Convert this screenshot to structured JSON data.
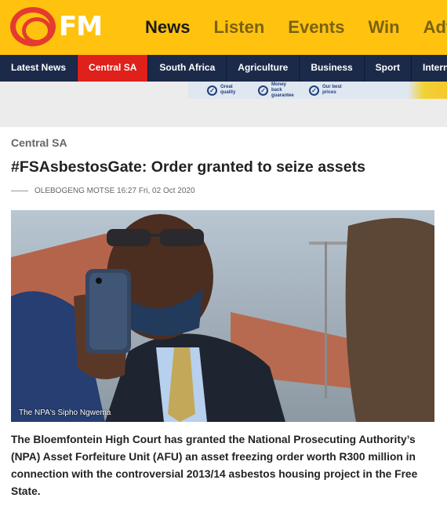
{
  "header": {
    "logo_text": "OFM",
    "nav": [
      {
        "label": "News",
        "active": true
      },
      {
        "label": "Listen",
        "active": false
      },
      {
        "label": "Events",
        "active": false
      },
      {
        "label": "Win",
        "active": false
      },
      {
        "label": "Adv",
        "active": false
      }
    ]
  },
  "subnav": [
    {
      "label": "Latest News",
      "active": false
    },
    {
      "label": "Central SA",
      "active": true
    },
    {
      "label": "South Africa",
      "active": false
    },
    {
      "label": "Agriculture",
      "active": false
    },
    {
      "label": "Business",
      "active": false
    },
    {
      "label": "Sport",
      "active": false
    },
    {
      "label": "Intern",
      "active": false
    }
  ],
  "ad": {
    "items": [
      "Great\nquality",
      "Money back\nguarantee",
      "Our best\nprices"
    ]
  },
  "article": {
    "category": "Central SA",
    "title": "#FSAsbestosGate: Order granted to seize assets",
    "author": "OLEBOGENG MOTSE",
    "time": "16:27",
    "date": "Fri, 02 Oct 2020",
    "image_caption": "The NPA's Sipho Ngwema",
    "lede": "The Bloemfontein High Court has granted the National Prosecuting Authority’s (NPA) Asset Forfeiture Unit (AFU) an asset freezing order worth R300 million in connection with the controversial 2013/14 asbestos housing project in the Free State."
  },
  "colors": {
    "header_yellow": "#ffc20e",
    "subnav_navy": "#1c2a4a",
    "active_red": "#e0201a"
  }
}
